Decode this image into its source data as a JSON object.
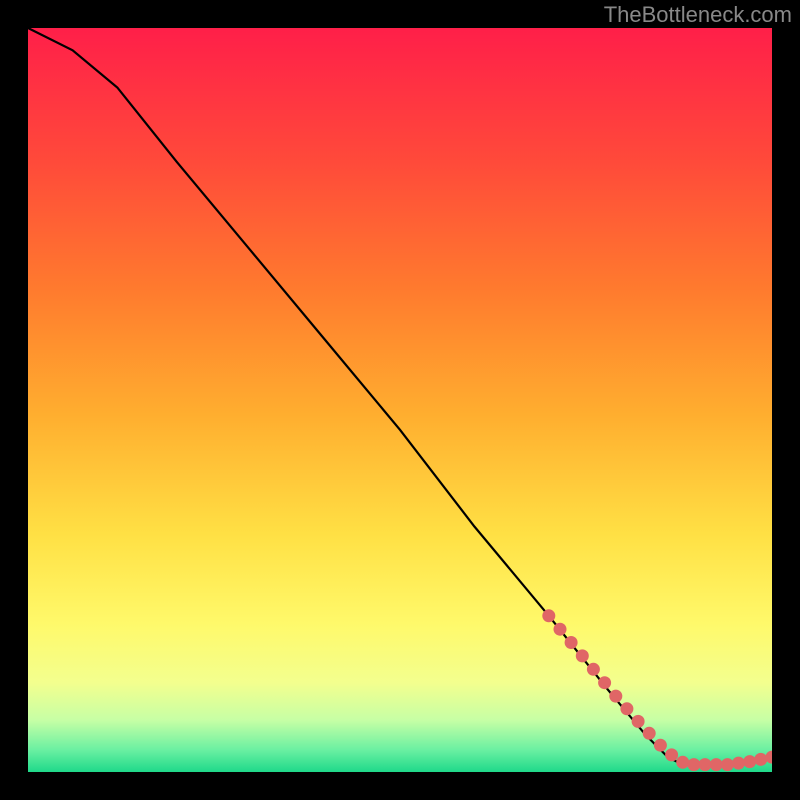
{
  "watermark": "TheBottleneck.com",
  "chart_data": {
    "type": "line",
    "title": "",
    "xlabel": "",
    "ylabel": "",
    "xlim": [
      0,
      100
    ],
    "ylim": [
      0,
      100
    ],
    "curve": {
      "name": "bottleneck-curve",
      "points": [
        {
          "x": 0,
          "y": 100
        },
        {
          "x": 6,
          "y": 97
        },
        {
          "x": 12,
          "y": 92
        },
        {
          "x": 20,
          "y": 82
        },
        {
          "x": 30,
          "y": 70
        },
        {
          "x": 40,
          "y": 58
        },
        {
          "x": 50,
          "y": 46
        },
        {
          "x": 60,
          "y": 33
        },
        {
          "x": 70,
          "y": 21
        },
        {
          "x": 78,
          "y": 11
        },
        {
          "x": 83,
          "y": 5
        },
        {
          "x": 86,
          "y": 2
        },
        {
          "x": 88,
          "y": 1
        },
        {
          "x": 92,
          "y": 1
        },
        {
          "x": 96,
          "y": 1
        },
        {
          "x": 100,
          "y": 2
        }
      ]
    },
    "highlighted": {
      "name": "highlighted-segment",
      "color": "#e06666",
      "points": [
        {
          "x": 70,
          "y": 21
        },
        {
          "x": 71.5,
          "y": 19.2
        },
        {
          "x": 73,
          "y": 17.4
        },
        {
          "x": 74.5,
          "y": 15.6
        },
        {
          "x": 76,
          "y": 13.8
        },
        {
          "x": 77.5,
          "y": 12
        },
        {
          "x": 79,
          "y": 10.2
        },
        {
          "x": 80.5,
          "y": 8.5
        },
        {
          "x": 82,
          "y": 6.8
        },
        {
          "x": 83.5,
          "y": 5.2
        },
        {
          "x": 85,
          "y": 3.6
        },
        {
          "x": 86.5,
          "y": 2.3
        },
        {
          "x": 88,
          "y": 1.3
        },
        {
          "x": 89.5,
          "y": 1.0
        },
        {
          "x": 91,
          "y": 1.0
        },
        {
          "x": 92.5,
          "y": 1.0
        },
        {
          "x": 94,
          "y": 1.0
        },
        {
          "x": 95.5,
          "y": 1.2
        },
        {
          "x": 97,
          "y": 1.4
        },
        {
          "x": 98.5,
          "y": 1.7
        },
        {
          "x": 100,
          "y": 2.0
        }
      ]
    },
    "background": {
      "type": "vertical-gradient",
      "stops": [
        {
          "pos": 0.0,
          "color": "#ff1f49"
        },
        {
          "pos": 0.18,
          "color": "#ff4a3a"
        },
        {
          "pos": 0.35,
          "color": "#ff7a2e"
        },
        {
          "pos": 0.52,
          "color": "#ffae2f"
        },
        {
          "pos": 0.68,
          "color": "#ffe044"
        },
        {
          "pos": 0.8,
          "color": "#fff96a"
        },
        {
          "pos": 0.88,
          "color": "#f3ff8e"
        },
        {
          "pos": 0.93,
          "color": "#c7ffa5"
        },
        {
          "pos": 0.97,
          "color": "#6bf0a2"
        },
        {
          "pos": 1.0,
          "color": "#1fd98a"
        }
      ]
    }
  }
}
